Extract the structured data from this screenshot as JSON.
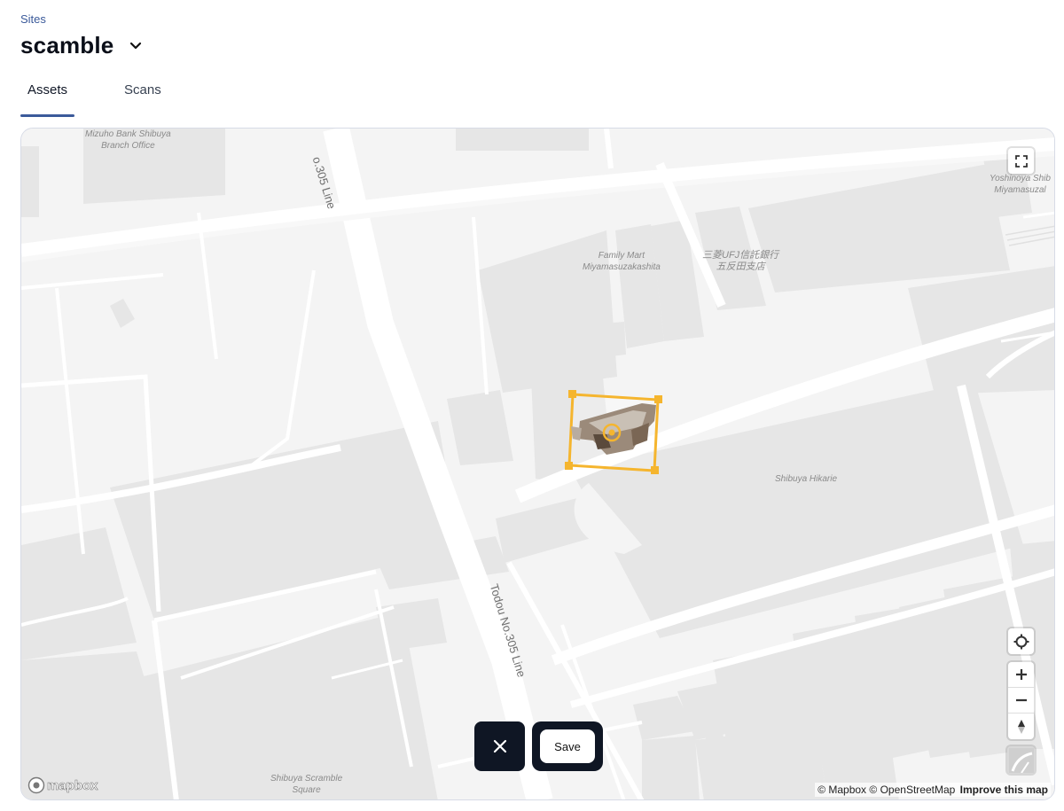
{
  "breadcrumb": "Sites",
  "site_title": "scamble",
  "tabs": [
    {
      "label": "Assets",
      "active": true
    },
    {
      "label": "Scans",
      "active": false
    }
  ],
  "map": {
    "labels": {
      "mizuho": "Mizuho Bank Shibuya\nBranch Office",
      "familymart": "Family Mart\nMiyamasuzakashita",
      "mufg": "三菱UFJ信託銀行\n五反田支店",
      "yoshinoya": "Yoshinoya Shib\nMiyamasuzal",
      "hikarie": "Shibuya Hikarie",
      "scramble_square": "Shibuya Scramble\nSquare"
    },
    "roads": {
      "top": "o.305 Line",
      "bottom": "Todou No.305 Line"
    },
    "logo_text": "mapbox",
    "attribution": {
      "mapbox": "© Mapbox",
      "osm": "© OpenStreetMap",
      "improve": "Improve this map"
    },
    "colors": {
      "selection": "#f5b52e",
      "action_dark": "#0f1624",
      "accent": "#3b5a9a"
    }
  },
  "actions": {
    "save_label": "Save"
  }
}
